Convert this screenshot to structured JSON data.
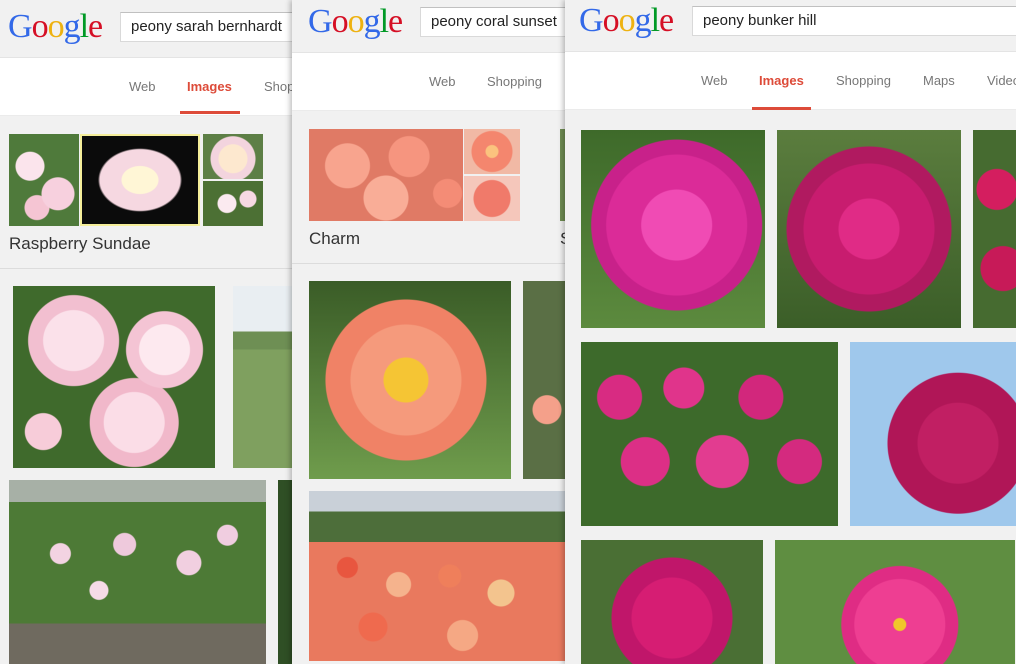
{
  "logo": {
    "letters": [
      "G",
      "o",
      "o",
      "g",
      "l",
      "e"
    ],
    "colors": [
      "#3369e8",
      "#d50f25",
      "#eeb211",
      "#3369e8",
      "#009925",
      "#d50f25"
    ]
  },
  "windows": [
    {
      "query": "peony sarah bernhardt",
      "tabs": [
        "Web",
        "Images",
        "Shop"
      ],
      "active_tab": "Images",
      "carousel_label": "Raspberry Sundae"
    },
    {
      "query": "peony coral sunset",
      "tabs": [
        "Web",
        "Shopping"
      ],
      "carousel_label": "Charm",
      "carousel_next_label": "S"
    },
    {
      "query": "peony bunker hill",
      "tabs": [
        "Web",
        "Images",
        "Shopping",
        "Maps",
        "Video"
      ],
      "active_tab": "Images"
    }
  ],
  "colors": {
    "active_tab": "#dd4b39",
    "light_pink": "#f4c6d6",
    "coral": "#f58a6e",
    "magenta": "#d4257a"
  }
}
